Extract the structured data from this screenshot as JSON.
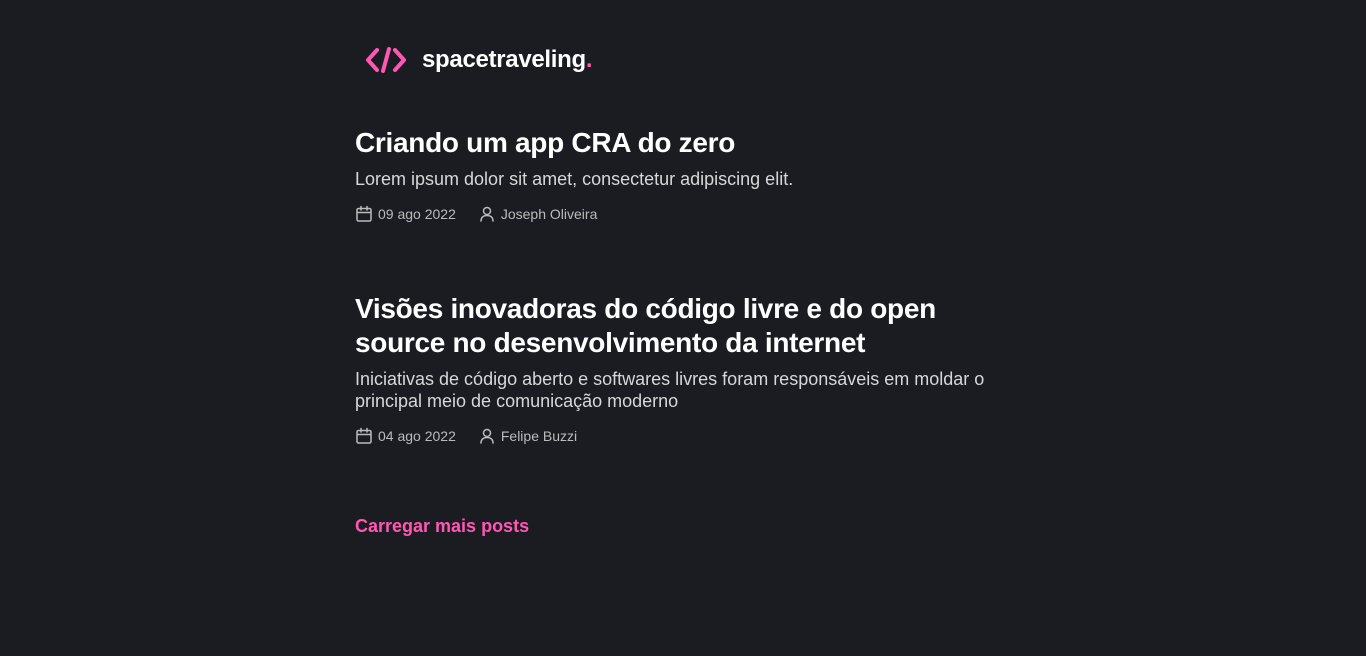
{
  "header": {
    "logo_text": "spacetraveling",
    "logo_dot": "."
  },
  "colors": {
    "background": "#1b1c22",
    "accent": "#ff57b2",
    "title": "#ffffff",
    "subtitle": "#d7d7d7",
    "info": "#bbbbbb"
  },
  "posts": [
    {
      "title": "Criando um app CRA do zero",
      "subtitle": "Lorem ipsum dolor sit amet, consectetur adipiscing elit.",
      "date": "09 ago 2022",
      "author": "Joseph Oliveira",
      "date_icon": "calendar-icon",
      "author_icon": "user-icon"
    },
    {
      "title": "Visões inovadoras do código livre e do open source no desenvolvimento da internet",
      "subtitle": "Iniciativas de código aberto e softwares livres foram responsáveis em moldar o principal meio de comunicação moderno",
      "date": "04 ago 2022",
      "author": "Felipe Buzzi",
      "date_icon": "calendar-icon",
      "author_icon": "user-icon"
    }
  ],
  "load_more_label": "Carregar mais posts"
}
